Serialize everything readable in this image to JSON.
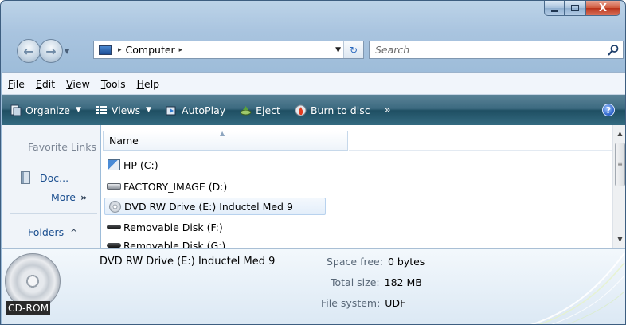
{
  "window": {
    "controls": {
      "minimize": "",
      "maximize": "",
      "close": "X"
    }
  },
  "address_bar": {
    "breadcrumb_sep": "▸",
    "location": "Computer",
    "trailing_sep": "▸",
    "search_placeholder": "Search"
  },
  "menu": [
    {
      "acc": "F",
      "rest": "ile"
    },
    {
      "acc": "E",
      "rest": "dit"
    },
    {
      "acc": "V",
      "rest": "iew"
    },
    {
      "acc": "T",
      "rest": "ools"
    },
    {
      "acc": "H",
      "rest": "elp"
    }
  ],
  "commands": {
    "organize": "Organize",
    "views": "Views",
    "autoplay": "AutoPlay",
    "eject": "Eject",
    "burn": "Burn to disc",
    "more": "»",
    "help": "?"
  },
  "left_pane": {
    "heading": "Favorite Links",
    "doc_link": "Doc...",
    "more": "More",
    "more_chevron": "»",
    "folders": "Folders",
    "folders_caret": "^"
  },
  "file_list": {
    "column_name": "Name",
    "items": [
      {
        "label": "HP (C:)",
        "icon": "hp-drive-icon"
      },
      {
        "label": "FACTORY_IMAGE (D:)",
        "icon": "hard-drive-icon"
      },
      {
        "label": "DVD RW Drive (E:) Inductel Med 9",
        "icon": "dvd-drive-icon",
        "selected": true
      },
      {
        "label": "Removable Disk (F:)",
        "icon": "removable-disk-icon"
      },
      {
        "label": "Removable Disk (G:)",
        "icon": "removable-disk-icon"
      }
    ]
  },
  "details": {
    "name": "DVD RW Drive (E:) Inductel Med 9",
    "badge": "CD-ROM",
    "space_free_label": "Space free:",
    "space_free_value": "0 bytes",
    "total_size_label": "Total size:",
    "total_size_value": "182 MB",
    "file_system_label": "File system:",
    "file_system_value": "UDF"
  },
  "colors": {
    "command_bar": "#2b5d73",
    "window_frame": "#a9c4df",
    "link": "#1a4e8f"
  }
}
